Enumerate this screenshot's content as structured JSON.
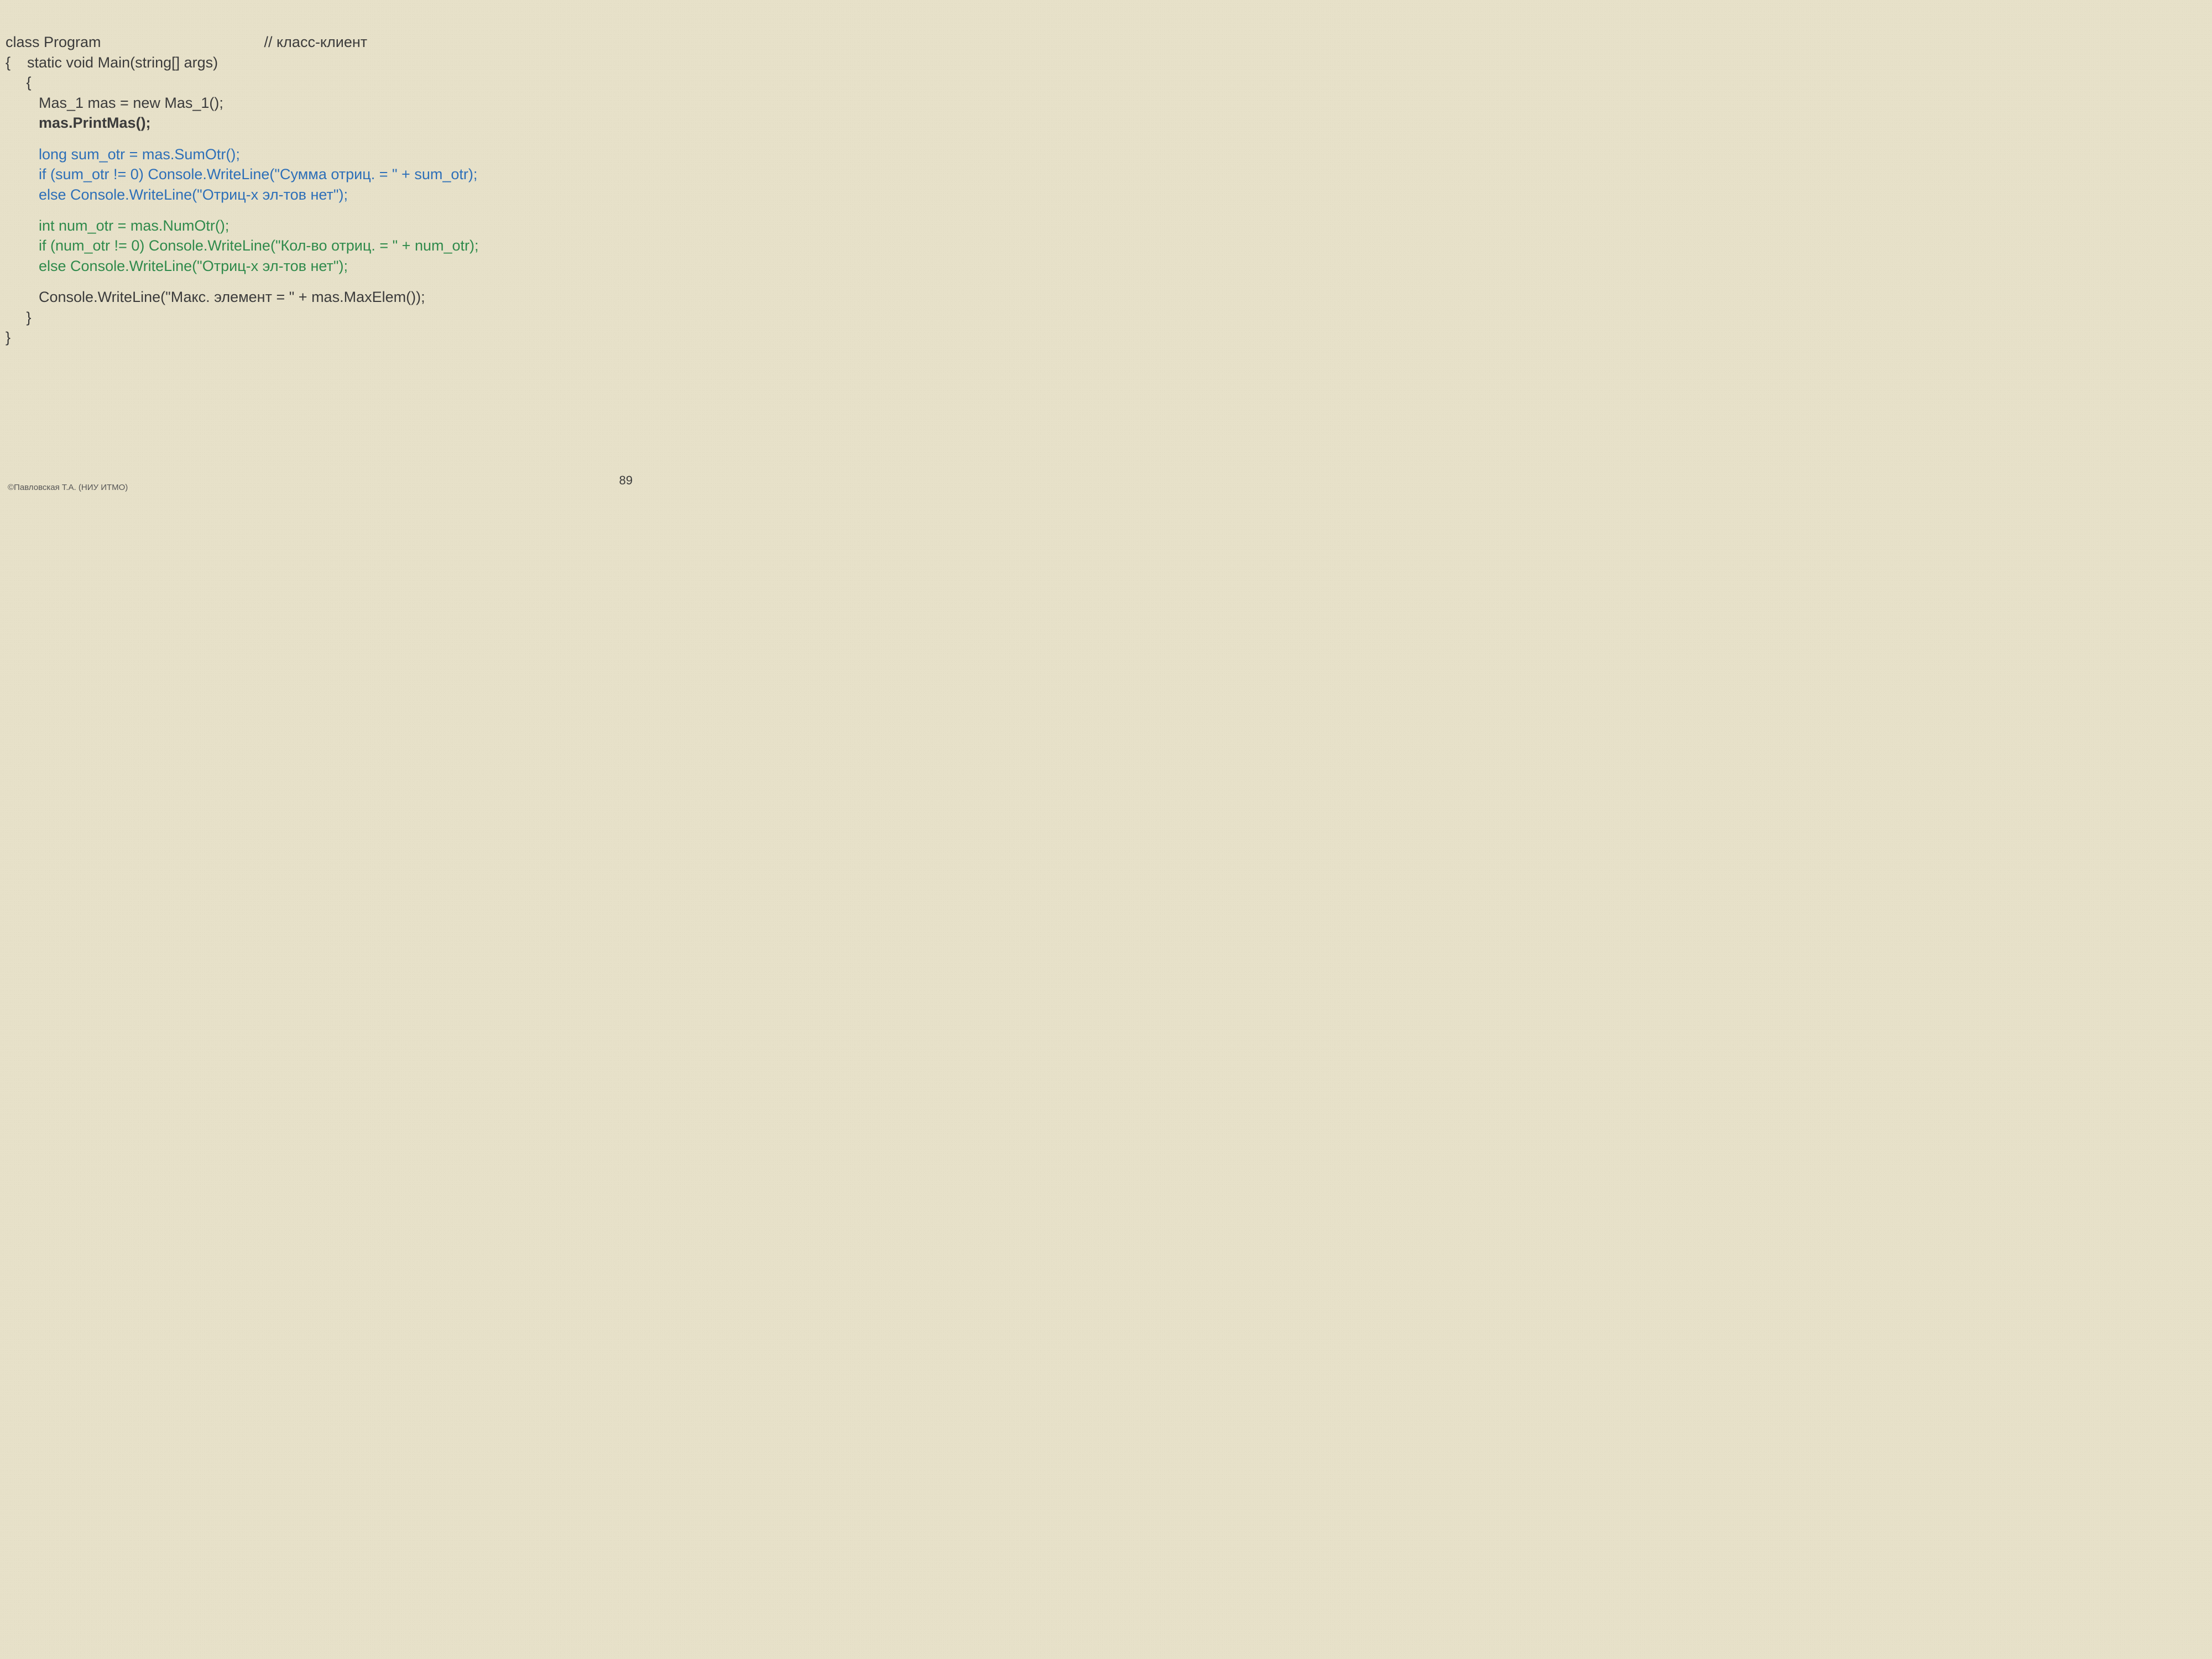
{
  "code": {
    "l1a": "class Program",
    "l1b": "// класс-клиент",
    "l2": "{    static void Main(string[] args)",
    "l3": "     {",
    "l4": "        Mas_1 mas = new Mas_1();",
    "l5": "        mas.PrintMas();",
    "l6": "        long sum_otr = mas.SumOtr();",
    "l7": "        if (sum_otr != 0) Console.WriteLine(\"Сумма отриц. = \" + sum_otr);",
    "l8": "        else Console.WriteLine(\"Отриц-х эл-тов нет\");",
    "l9": "        int num_otr = mas.NumOtr();",
    "l10": "        if (num_otr != 0) Console.WriteLine(\"Кол-во отриц. = \" + num_otr);",
    "l11": "        else Console.WriteLine(\"Отриц-х эл-тов нет\");",
    "l12": "        Console.WriteLine(\"Макс. элемент = \" + mas.MaxElem());",
    "l13": "     }",
    "l14": "}"
  },
  "footer": "©Павловская Т.А. (НИУ ИТМО)",
  "page": "89"
}
